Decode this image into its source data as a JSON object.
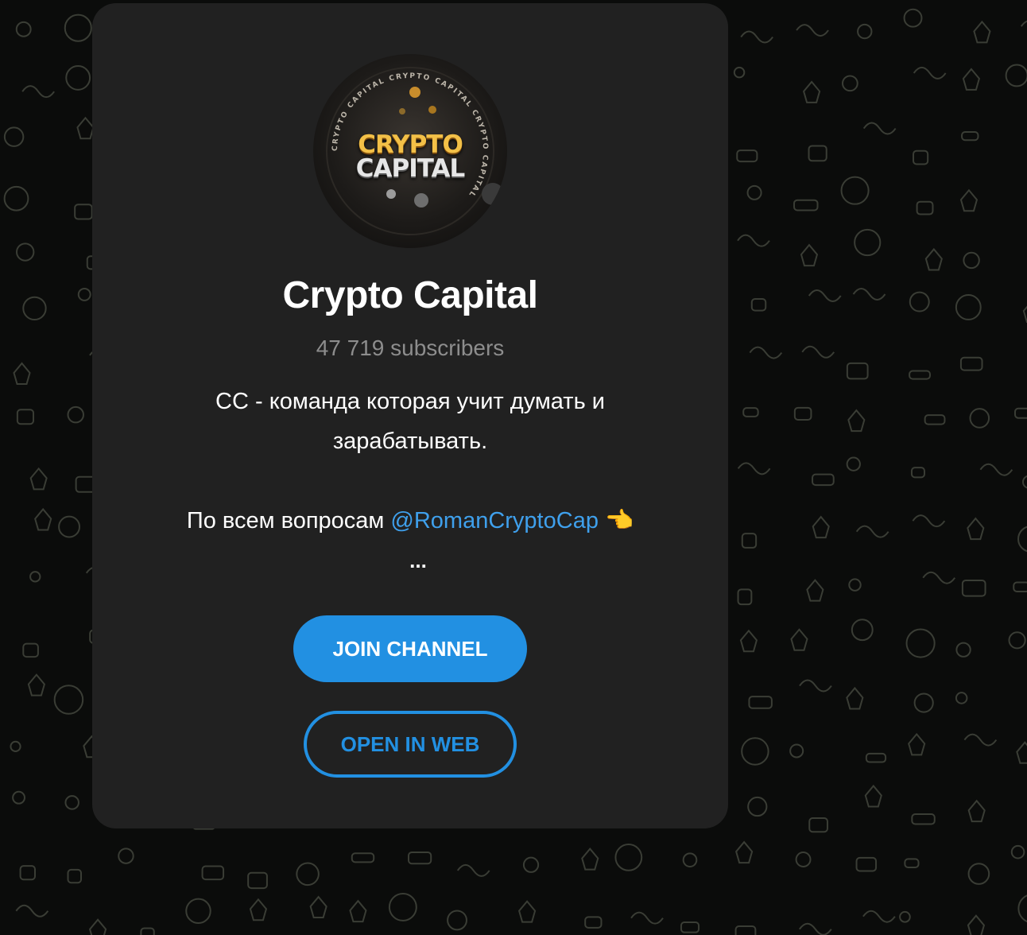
{
  "channel": {
    "logo_text_top": "CRYPTO",
    "logo_text_bottom": "CAPITAL",
    "logo_ring_text": "CRYPTO CAPITAL CRYPTO CAPITAL CRYPTO CAPITAL",
    "name": "Crypto Capital",
    "subscribers": "47 719 subscribers",
    "description_line1": "CC - команда которая учит думать и",
    "description_line2": "зарабатывать.",
    "description_line3_prefix": "По всем вопросам ",
    "description_mention": "@RomanCryptoCap",
    "description_emoji": " 👈",
    "ellipsis": "..."
  },
  "buttons": {
    "join_label": "JOIN CHANNEL",
    "web_label": "OPEN IN WEB"
  },
  "colors": {
    "accent": "#2290e2",
    "card_bg": "#212121",
    "page_bg": "#0b0c0b",
    "mention": "#3fa0ec",
    "muted_text": "#8d8d8d"
  }
}
